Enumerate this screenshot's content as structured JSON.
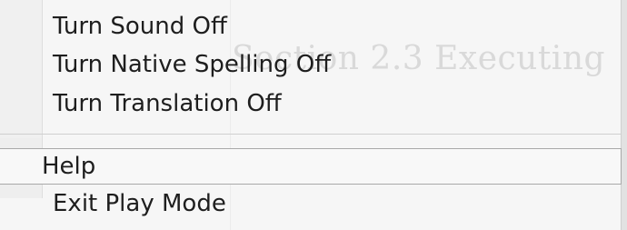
{
  "menu": {
    "background_text": "Section 2.3 Executing",
    "items": [
      {
        "label": "Turn Sound Off"
      },
      {
        "label": "Turn Native Spelling Off"
      },
      {
        "label": "Turn Translation Off"
      },
      {
        "label": "Help"
      },
      {
        "label": "Exit Play Mode"
      }
    ]
  }
}
